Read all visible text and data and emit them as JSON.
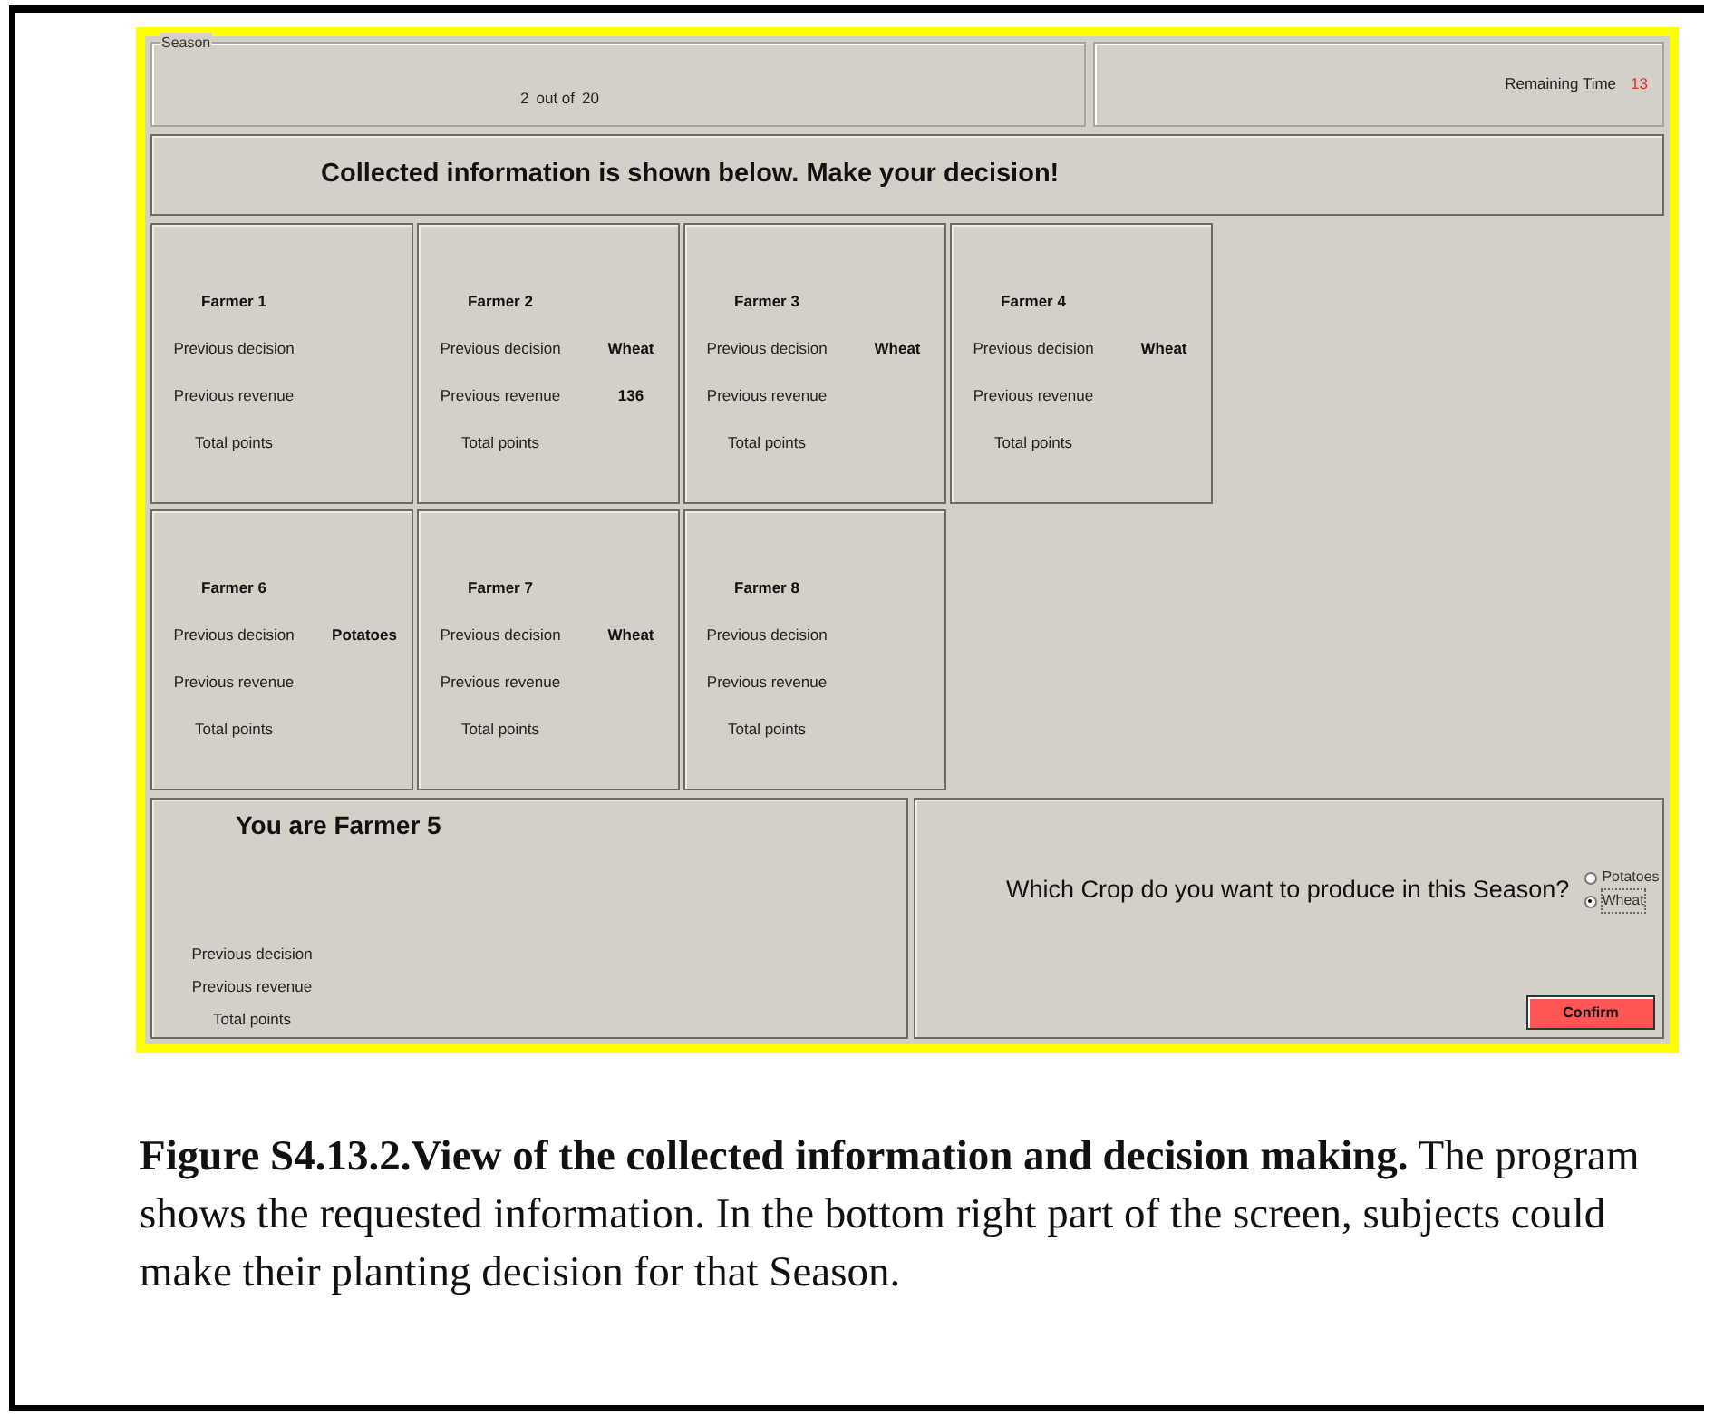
{
  "season": {
    "legend": "Season",
    "current": "2",
    "out_of": "out of",
    "total": "20"
  },
  "remaining": {
    "label": "Remaining Time",
    "value": "13"
  },
  "banner": "Collected information is shown below. Make your decision!",
  "farmer_grid": [
    {
      "kind": "farmer",
      "title": "Farmer 1",
      "rows": [
        {
          "label": "Previous decision"
        },
        {
          "label": "Previous revenue"
        },
        {
          "label": "Total points"
        }
      ]
    },
    {
      "kind": "farmer",
      "title": "Farmer 2",
      "rows": [
        {
          "label": "Previous decision",
          "value": "Wheat"
        },
        {
          "label": "Previous revenue",
          "value": "136"
        },
        {
          "label": "Total points"
        }
      ]
    },
    {
      "kind": "farmer",
      "title": "Farmer 3",
      "rows": [
        {
          "label": "Previous decision",
          "value": "Wheat"
        },
        {
          "label": "Previous revenue"
        },
        {
          "label": "Total points"
        }
      ]
    },
    {
      "kind": "farmer",
      "title": "Farmer 4",
      "rows": [
        {
          "label": "Previous decision",
          "value": "Wheat"
        },
        {
          "label": "Previous revenue"
        },
        {
          "label": "Total points"
        }
      ]
    },
    {
      "kind": "empty"
    },
    {
      "kind": "farmer",
      "title": "Farmer 6",
      "rows": [
        {
          "label": "Previous decision",
          "value": "Potatoes"
        },
        {
          "label": "Previous revenue"
        },
        {
          "label": "Total points"
        }
      ]
    },
    {
      "kind": "farmer",
      "title": "Farmer 7",
      "rows": [
        {
          "label": "Previous decision",
          "value": "Wheat"
        },
        {
          "label": "Previous revenue"
        },
        {
          "label": "Total points"
        }
      ]
    },
    {
      "kind": "farmer",
      "title": "Farmer 8",
      "rows": [
        {
          "label": "Previous decision"
        },
        {
          "label": "Previous revenue"
        },
        {
          "label": "Total points"
        }
      ]
    }
  ],
  "own_panel": {
    "title": "You are Farmer 5",
    "rows": [
      {
        "label": "Previous decision"
      },
      {
        "label": "Previous revenue"
      },
      {
        "label": "Total points"
      }
    ]
  },
  "decision": {
    "question": "Which Crop do you want to produce in this Season?",
    "options": [
      {
        "label": "Potatoes",
        "selected": false
      },
      {
        "label": "Wheat",
        "selected": true
      }
    ],
    "confirm": "Confirm"
  },
  "caption": "**Figure S4.13.2.View of the collected information and decision making.** The program shows the requested information. In the bottom right part of the screen, subjects could make their planting decision for that Season."
}
